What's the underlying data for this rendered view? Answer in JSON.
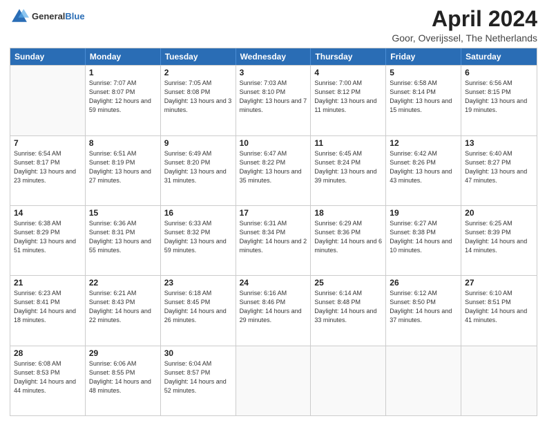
{
  "header": {
    "logo_general": "General",
    "logo_blue": "Blue",
    "title": "April 2024",
    "location": "Goor, Overijssel, The Netherlands"
  },
  "calendar": {
    "days": [
      "Sunday",
      "Monday",
      "Tuesday",
      "Wednesday",
      "Thursday",
      "Friday",
      "Saturday"
    ],
    "weeks": [
      [
        {
          "day": "",
          "empty": true
        },
        {
          "day": "1",
          "sunrise": "Sunrise: 7:07 AM",
          "sunset": "Sunset: 8:07 PM",
          "daylight": "Daylight: 12 hours and 59 minutes."
        },
        {
          "day": "2",
          "sunrise": "Sunrise: 7:05 AM",
          "sunset": "Sunset: 8:08 PM",
          "daylight": "Daylight: 13 hours and 3 minutes."
        },
        {
          "day": "3",
          "sunrise": "Sunrise: 7:03 AM",
          "sunset": "Sunset: 8:10 PM",
          "daylight": "Daylight: 13 hours and 7 minutes."
        },
        {
          "day": "4",
          "sunrise": "Sunrise: 7:00 AM",
          "sunset": "Sunset: 8:12 PM",
          "daylight": "Daylight: 13 hours and 11 minutes."
        },
        {
          "day": "5",
          "sunrise": "Sunrise: 6:58 AM",
          "sunset": "Sunset: 8:14 PM",
          "daylight": "Daylight: 13 hours and 15 minutes."
        },
        {
          "day": "6",
          "sunrise": "Sunrise: 6:56 AM",
          "sunset": "Sunset: 8:15 PM",
          "daylight": "Daylight: 13 hours and 19 minutes."
        }
      ],
      [
        {
          "day": "7",
          "sunrise": "Sunrise: 6:54 AM",
          "sunset": "Sunset: 8:17 PM",
          "daylight": "Daylight: 13 hours and 23 minutes."
        },
        {
          "day": "8",
          "sunrise": "Sunrise: 6:51 AM",
          "sunset": "Sunset: 8:19 PM",
          "daylight": "Daylight: 13 hours and 27 minutes."
        },
        {
          "day": "9",
          "sunrise": "Sunrise: 6:49 AM",
          "sunset": "Sunset: 8:20 PM",
          "daylight": "Daylight: 13 hours and 31 minutes."
        },
        {
          "day": "10",
          "sunrise": "Sunrise: 6:47 AM",
          "sunset": "Sunset: 8:22 PM",
          "daylight": "Daylight: 13 hours and 35 minutes."
        },
        {
          "day": "11",
          "sunrise": "Sunrise: 6:45 AM",
          "sunset": "Sunset: 8:24 PM",
          "daylight": "Daylight: 13 hours and 39 minutes."
        },
        {
          "day": "12",
          "sunrise": "Sunrise: 6:42 AM",
          "sunset": "Sunset: 8:26 PM",
          "daylight": "Daylight: 13 hours and 43 minutes."
        },
        {
          "day": "13",
          "sunrise": "Sunrise: 6:40 AM",
          "sunset": "Sunset: 8:27 PM",
          "daylight": "Daylight: 13 hours and 47 minutes."
        }
      ],
      [
        {
          "day": "14",
          "sunrise": "Sunrise: 6:38 AM",
          "sunset": "Sunset: 8:29 PM",
          "daylight": "Daylight: 13 hours and 51 minutes."
        },
        {
          "day": "15",
          "sunrise": "Sunrise: 6:36 AM",
          "sunset": "Sunset: 8:31 PM",
          "daylight": "Daylight: 13 hours and 55 minutes."
        },
        {
          "day": "16",
          "sunrise": "Sunrise: 6:33 AM",
          "sunset": "Sunset: 8:32 PM",
          "daylight": "Daylight: 13 hours and 59 minutes."
        },
        {
          "day": "17",
          "sunrise": "Sunrise: 6:31 AM",
          "sunset": "Sunset: 8:34 PM",
          "daylight": "Daylight: 14 hours and 2 minutes."
        },
        {
          "day": "18",
          "sunrise": "Sunrise: 6:29 AM",
          "sunset": "Sunset: 8:36 PM",
          "daylight": "Daylight: 14 hours and 6 minutes."
        },
        {
          "day": "19",
          "sunrise": "Sunrise: 6:27 AM",
          "sunset": "Sunset: 8:38 PM",
          "daylight": "Daylight: 14 hours and 10 minutes."
        },
        {
          "day": "20",
          "sunrise": "Sunrise: 6:25 AM",
          "sunset": "Sunset: 8:39 PM",
          "daylight": "Daylight: 14 hours and 14 minutes."
        }
      ],
      [
        {
          "day": "21",
          "sunrise": "Sunrise: 6:23 AM",
          "sunset": "Sunset: 8:41 PM",
          "daylight": "Daylight: 14 hours and 18 minutes."
        },
        {
          "day": "22",
          "sunrise": "Sunrise: 6:21 AM",
          "sunset": "Sunset: 8:43 PM",
          "daylight": "Daylight: 14 hours and 22 minutes."
        },
        {
          "day": "23",
          "sunrise": "Sunrise: 6:18 AM",
          "sunset": "Sunset: 8:45 PM",
          "daylight": "Daylight: 14 hours and 26 minutes."
        },
        {
          "day": "24",
          "sunrise": "Sunrise: 6:16 AM",
          "sunset": "Sunset: 8:46 PM",
          "daylight": "Daylight: 14 hours and 29 minutes."
        },
        {
          "day": "25",
          "sunrise": "Sunrise: 6:14 AM",
          "sunset": "Sunset: 8:48 PM",
          "daylight": "Daylight: 14 hours and 33 minutes."
        },
        {
          "day": "26",
          "sunrise": "Sunrise: 6:12 AM",
          "sunset": "Sunset: 8:50 PM",
          "daylight": "Daylight: 14 hours and 37 minutes."
        },
        {
          "day": "27",
          "sunrise": "Sunrise: 6:10 AM",
          "sunset": "Sunset: 8:51 PM",
          "daylight": "Daylight: 14 hours and 41 minutes."
        }
      ],
      [
        {
          "day": "28",
          "sunrise": "Sunrise: 6:08 AM",
          "sunset": "Sunset: 8:53 PM",
          "daylight": "Daylight: 14 hours and 44 minutes."
        },
        {
          "day": "29",
          "sunrise": "Sunrise: 6:06 AM",
          "sunset": "Sunset: 8:55 PM",
          "daylight": "Daylight: 14 hours and 48 minutes."
        },
        {
          "day": "30",
          "sunrise": "Sunrise: 6:04 AM",
          "sunset": "Sunset: 8:57 PM",
          "daylight": "Daylight: 14 hours and 52 minutes."
        },
        {
          "day": "",
          "empty": true
        },
        {
          "day": "",
          "empty": true
        },
        {
          "day": "",
          "empty": true
        },
        {
          "day": "",
          "empty": true
        }
      ]
    ]
  }
}
